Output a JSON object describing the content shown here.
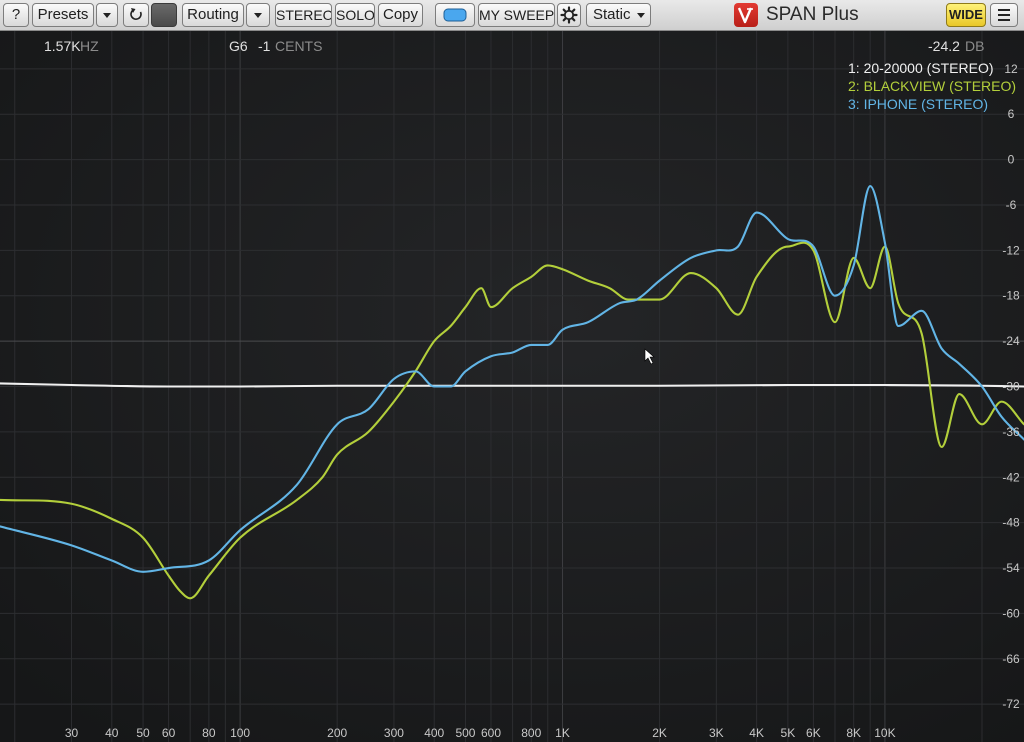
{
  "toolbar": {
    "help_label": "?",
    "presets_label": "Presets",
    "routing_label": "Routing",
    "stereo_label": "STEREO",
    "solo_label": "SOLO",
    "copy_label": "Copy",
    "sweep_label": "MY SWEEP",
    "static_label": "Static",
    "brand": "SPAN Plus",
    "wide_label": "WIDE"
  },
  "readout": {
    "freq_value": "1.57K",
    "freq_unit": "HZ",
    "note": "G6",
    "cents_value": "-1",
    "cents_unit": "CENTS",
    "level_value": "-24.2",
    "level_unit": "DB"
  },
  "legend": [
    {
      "label": "1: 20-20000 (STEREO)",
      "color": "#f0f0f0"
    },
    {
      "label": "2: BLACKVIEW (STEREO)",
      "color": "#b3cf3b"
    },
    {
      "label": "3: IPHONE (STEREO)",
      "color": "#62b5e6"
    }
  ],
  "chart_data": {
    "type": "line",
    "x_scale": "log",
    "xlim": [
      18,
      27000
    ],
    "ylim": [
      -77,
      17
    ],
    "x_ticks": [
      30,
      40,
      50,
      60,
      80,
      100,
      200,
      300,
      400,
      500,
      600,
      800,
      1000,
      2000,
      3000,
      4000,
      5000,
      6000,
      8000,
      10000
    ],
    "x_tick_labels": [
      "30",
      "40",
      "50",
      "60",
      "80",
      "100",
      "200",
      "300",
      "400",
      "500",
      "600",
      "800",
      "1K",
      "2K",
      "3K",
      "4K",
      "5K",
      "6K",
      "8K",
      "10K"
    ],
    "y_ticks": [
      12,
      6,
      0,
      -6,
      -12,
      -18,
      -24,
      -30,
      -36,
      -42,
      -48,
      -54,
      -60,
      -66,
      -72
    ],
    "grid": true,
    "legend_position": "top-right",
    "series": [
      {
        "name": "1: 20-20000 (STEREO)",
        "color": "#f0f0f0",
        "x": [
          18,
          30,
          60,
          100,
          200,
          300,
          500,
          1000,
          2000,
          5000,
          10000,
          20000,
          27000
        ],
        "y": [
          -29.6,
          -29.8,
          -30.0,
          -30.0,
          -29.9,
          -29.9,
          -29.9,
          -29.9,
          -29.9,
          -29.8,
          -29.8,
          -29.9,
          -30.0
        ]
      },
      {
        "name": "2: BLACKVIEW (STEREO)",
        "color": "#b3cf3b",
        "x": [
          18,
          30,
          40,
          50,
          60,
          65,
          70,
          80,
          100,
          150,
          180,
          200,
          250,
          300,
          350,
          400,
          450,
          500,
          560,
          600,
          700,
          800,
          900,
          1000,
          1200,
          1400,
          1600,
          2000,
          2500,
          3000,
          3500,
          4000,
          5000,
          6000,
          7000,
          8000,
          9000,
          10000,
          11000,
          13000,
          15000,
          17000,
          20000,
          23000,
          27000
        ],
        "y": [
          -45.0,
          -45.5,
          -47.5,
          -50.0,
          -55.0,
          -57.0,
          -58.0,
          -55.0,
          -50.0,
          -45.0,
          -42.0,
          -39.0,
          -36.0,
          -32.0,
          -28.0,
          -24.0,
          -22.0,
          -19.5,
          -17.0,
          -19.5,
          -17.0,
          -15.5,
          -14.0,
          -14.5,
          -16.0,
          -17.0,
          -18.5,
          -18.5,
          -15.0,
          -17.0,
          -20.5,
          -15.5,
          -11.5,
          -12.0,
          -21.5,
          -13.0,
          -17.0,
          -11.5,
          -19.0,
          -23.0,
          -38.0,
          -31.0,
          -35.0,
          -32.0,
          -35.0
        ]
      },
      {
        "name": "3: IPHONE (STEREO)",
        "color": "#62b5e6",
        "x": [
          18,
          30,
          40,
          50,
          60,
          80,
          100,
          150,
          200,
          250,
          300,
          350,
          400,
          450,
          500,
          600,
          700,
          800,
          900,
          1000,
          1200,
          1500,
          1700,
          2000,
          2500,
          3000,
          3500,
          4000,
          5000,
          6000,
          7000,
          8000,
          9000,
          10000,
          11000,
          13000,
          15000,
          17000,
          20000,
          23000,
          27000
        ],
        "y": [
          -48.5,
          -51.0,
          -53.0,
          -54.5,
          -54.0,
          -53.0,
          -49.0,
          -43.0,
          -35.0,
          -33.0,
          -29.0,
          -28.0,
          -30.0,
          -30.0,
          -28.0,
          -26.0,
          -25.5,
          -24.5,
          -24.5,
          -22.5,
          -21.5,
          -19.0,
          -18.5,
          -16.0,
          -13.0,
          -12.0,
          -11.5,
          -7.0,
          -10.5,
          -11.5,
          -18.0,
          -14.0,
          -3.5,
          -11.0,
          -22.0,
          -20.0,
          -25.0,
          -27.0,
          -30.0,
          -34.0,
          -37.0
        ]
      }
    ]
  }
}
